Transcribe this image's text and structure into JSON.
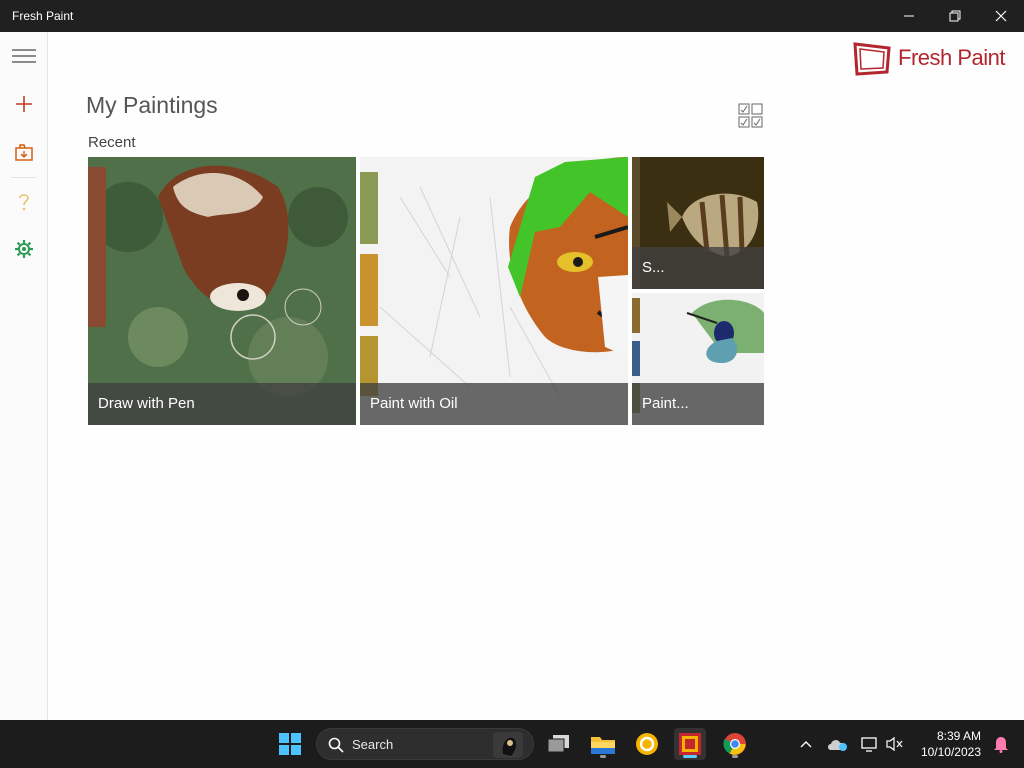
{
  "window": {
    "title": "Fresh Paint"
  },
  "app": {
    "logo_text": "Fresh Paint",
    "heading": "My Paintings",
    "section_label": "Recent",
    "brand_color": "#b4262d",
    "accent_green": "#2a9a55"
  },
  "paintings": [
    {
      "label": "Draw with Pen",
      "thumbnail": "red panda"
    },
    {
      "label": "Paint with Oil",
      "thumbnail": "tiger"
    },
    {
      "label": "S...",
      "thumbnail": "fish"
    },
    {
      "label": "Paint...",
      "thumbnail": "hummingbird"
    }
  ],
  "rail": {
    "items": [
      {
        "name": "menu-icon"
      },
      {
        "name": "add-icon"
      },
      {
        "name": "import-icon"
      },
      {
        "name": "help-icon"
      },
      {
        "name": "settings-icon"
      }
    ]
  },
  "taskbar": {
    "search_label": "Search",
    "time": "8:39 AM",
    "date": "10/10/2023",
    "apps": [
      "start-icon",
      "search",
      "task-view-icon",
      "file-explorer-icon",
      "norton-icon",
      "fresh-paint-icon",
      "chrome-icon"
    ]
  }
}
